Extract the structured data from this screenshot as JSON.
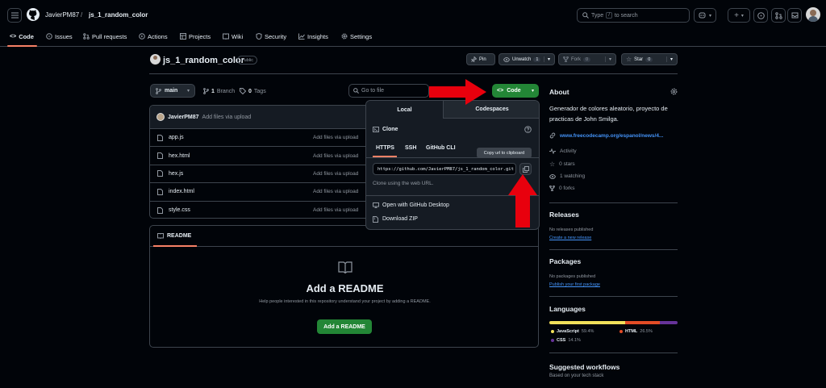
{
  "header": {
    "owner": "JavierPM87",
    "separator": "/",
    "repo": "js_1_random_color",
    "search_prefix": "Type",
    "search_key": "/",
    "search_suffix": "to search"
  },
  "nav": {
    "tabs": [
      "Code",
      "Issues",
      "Pull requests",
      "Actions",
      "Projects",
      "Wiki",
      "Security",
      "Insights",
      "Settings"
    ]
  },
  "repo": {
    "title": "js_1_random_color",
    "visibility": "Public",
    "pin_label": "Pin",
    "unwatch_label": "Unwatch",
    "watch_count": "1",
    "fork_label": "Fork",
    "fork_count": "0",
    "star_label": "Star",
    "star_count": "0"
  },
  "toolbar": {
    "branch": "main",
    "branch_count": "1",
    "branch_label": "Branch",
    "tag_count": "0",
    "tag_label": "Tags",
    "goto_placeholder": "Go to file",
    "code_label": "Code"
  },
  "commit": {
    "author": "JavierPM87",
    "message": "Add files via upload"
  },
  "files": [
    {
      "name": "app.js",
      "message": "Add files via upload"
    },
    {
      "name": "hex.html",
      "message": "Add files via upload"
    },
    {
      "name": "hex.js",
      "message": "Add files via upload"
    },
    {
      "name": "index.html",
      "message": "Add files via upload"
    },
    {
      "name": "style.css",
      "message": "Add files via upload"
    }
  ],
  "readme": {
    "tab_label": "README",
    "title": "Add a README",
    "subtitle": "Help people interested in this repository understand your project by adding a README.",
    "button": "Add a README"
  },
  "dropdown": {
    "tab_local": "Local",
    "tab_codespaces": "Codespaces",
    "clone_label": "Clone",
    "protocols": [
      "HTTPS",
      "SSH",
      "GitHub CLI"
    ],
    "url": "https://github.com/JavierPM87/js_1_random_color.git",
    "url_hint": "Clone using the web URL.",
    "open_desktop": "Open with GitHub Desktop",
    "download_zip": "Download ZIP",
    "tooltip": "Copy url to clipboard"
  },
  "about": {
    "title": "About",
    "description": "Generador de colores aleatorio, proyecto de practicas de John Smilga.",
    "website": "www.freecodecamp.org/espanol/news/4...",
    "activity": "Activity",
    "stars": "0 stars",
    "watching": "1 watching",
    "forks": "0 forks"
  },
  "releases": {
    "title": "Releases",
    "none": "No releases published",
    "link": "Create a new release"
  },
  "packages": {
    "title": "Packages",
    "none": "No packages published",
    "link": "Publish your first package"
  },
  "languages": {
    "title": "Languages",
    "items": [
      {
        "name": "JavaScript",
        "percent": "59.4%",
        "value": 59.4,
        "color": "#f1e05a"
      },
      {
        "name": "HTML",
        "percent": "26.5%",
        "value": 26.5,
        "color": "#e34c26"
      },
      {
        "name": "CSS",
        "percent": "14.1%",
        "value": 14.1,
        "color": "#663399"
      }
    ]
  },
  "workflows": {
    "title": "Suggested workflows",
    "subtitle": "Based on your tech stack"
  },
  "colors": {
    "accent_green": "#238636",
    "tab_underline": "#f78166",
    "link": "#4493f8",
    "arrow_red": "#e8000d"
  }
}
